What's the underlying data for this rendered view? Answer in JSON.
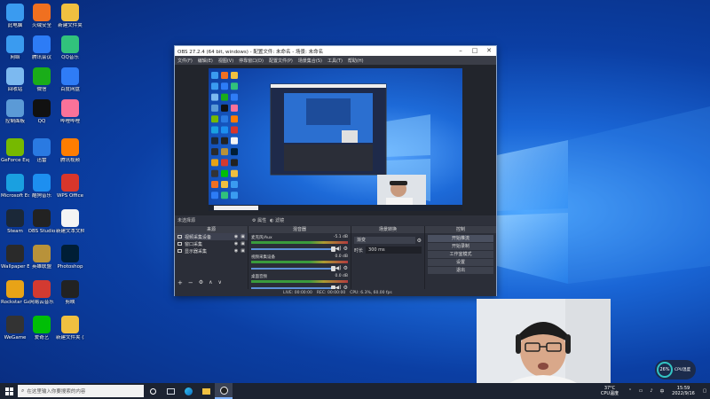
{
  "colors": {
    "accent": "#1a66d6",
    "obs_bg": "#2b2e38",
    "taskbar": "#1c2331",
    "meter_green": "#3fbf3f",
    "meter_red": "#e04040"
  },
  "desktop": {
    "icons": [
      {
        "label": "此电脑",
        "icon": "computer-icon",
        "color": "#3a9bf0"
      },
      {
        "label": "网络",
        "icon": "network-icon",
        "color": "#3a9bf0"
      },
      {
        "label": "回收站",
        "icon": "recycle-bin-icon",
        "color": "#7cb9f0"
      },
      {
        "label": "控制面板",
        "icon": "control-panel-icon",
        "color": "#5b9ad6"
      },
      {
        "label": "GeForce Experience",
        "icon": "nvidia-icon",
        "color": "#76b900"
      },
      {
        "label": "Microsoft Edge",
        "icon": "edge-icon",
        "color": "#1aa0e0"
      },
      {
        "label": "Steam",
        "icon": "steam-icon",
        "color": "#1b2838"
      },
      {
        "label": "Wallpaper Engine",
        "icon": "wallpaper-engine-icon",
        "color": "#2a2a2a"
      },
      {
        "label": "Rockstar Games Launcher",
        "icon": "rockstar-icon",
        "color": "#e8a317"
      },
      {
        "label": "WeGame",
        "icon": "wegame-icon",
        "color": "#333"
      },
      {
        "label": "火绒安全",
        "icon": "huorong-icon",
        "color": "#f07020"
      },
      {
        "label": "腾讯会议",
        "icon": "tencent-meeting-icon",
        "color": "#2d7cf6"
      },
      {
        "label": "微信",
        "icon": "wechat-icon",
        "color": "#1aad19"
      },
      {
        "label": "QQ",
        "icon": "qq-icon",
        "color": "#111"
      },
      {
        "label": "迅雷",
        "icon": "xunlei-icon",
        "color": "#2a7ae2"
      },
      {
        "label": "酷狗音乐",
        "icon": "kugou-icon",
        "color": "#1d8ff0"
      },
      {
        "label": "OBS Studio",
        "icon": "obs-icon",
        "color": "#222"
      },
      {
        "label": "英雄联盟",
        "icon": "lol-icon",
        "color": "#b8923a"
      },
      {
        "label": "网易云音乐",
        "icon": "netease-music-icon",
        "color": "#d33a31"
      },
      {
        "label": "爱奇艺",
        "icon": "iqiyi-icon",
        "color": "#00be06"
      },
      {
        "label": "新建文件夹",
        "icon": "folder-icon",
        "color": "#f0c040"
      },
      {
        "label": "QQ音乐",
        "icon": "qq-music-icon",
        "color": "#31c27c"
      },
      {
        "label": "百度网盘",
        "icon": "baidu-netdisk-icon",
        "color": "#2f7cf6"
      },
      {
        "label": "哔哩哔哩",
        "icon": "bilibili-icon",
        "color": "#fb7299"
      },
      {
        "label": "腾讯视频",
        "icon": "tencent-video-icon",
        "color": "#ff7d00"
      },
      {
        "label": "WPS Office",
        "icon": "wps-icon",
        "color": "#d8362b"
      },
      {
        "label": "新建文本文档",
        "icon": "text-doc-icon",
        "color": "#f4f4f4"
      },
      {
        "label": "Photoshop",
        "icon": "photoshop-icon",
        "color": "#001e36"
      },
      {
        "label": "剪映",
        "icon": "jianying-icon",
        "color": "#222"
      },
      {
        "label": "新建文件夹 (2)",
        "icon": "folder-icon",
        "color": "#f0c040"
      }
    ]
  },
  "obs": {
    "title": "OBS 27.2.4 (64 bit, windows) - 配置文件: 未命名 - 场景: 未命名",
    "menu": [
      "文件(F)",
      "编辑(E)",
      "视图(V)",
      "停靠窗口(D)",
      "配置文件(P)",
      "场景集合(S)",
      "工具(T)",
      "帮助(H)"
    ],
    "scene_bar_label": "未选择源",
    "scene_bar_props": "属性",
    "scene_bar_filters": "滤镜",
    "docks": {
      "sources_header": "来源",
      "sources": [
        {
          "label": "视频采集设备",
          "icon": "camera-icon"
        },
        {
          "label": "窗口采集",
          "icon": "window-icon"
        },
        {
          "label": "显示器采集",
          "icon": "monitor-icon"
        }
      ],
      "mixer_header": "混音器",
      "mixer": [
        {
          "label": "麦克风/Aux",
          "db": "-5.1 dB"
        },
        {
          "label": "视频采集设备",
          "db": "0.0 dB"
        },
        {
          "label": "桌面音频",
          "db": "0.0 dB"
        }
      ],
      "transition_header": "场景转换",
      "transition_type": "渐变",
      "duration_label": "时长",
      "duration_value": "300 ms",
      "controls_header": "控制",
      "controls": [
        "开始推流",
        "开始录制",
        "工作室模式",
        "设置",
        "退出"
      ]
    },
    "status": {
      "live": "LIVE: 00:00:00",
      "rec": "REC: 00:00:00",
      "cpu": "CPU: 6.3%, 60.00 fps"
    }
  },
  "taskbar": {
    "search_placeholder": "在这里输入你要搜索的内容",
    "weather_temp": "37°C",
    "weather_text": "CPU温度",
    "time": "15:59",
    "date": "2022/9/16"
  },
  "cpu_widget": {
    "percent": "26%",
    "label": "CPU温度"
  }
}
